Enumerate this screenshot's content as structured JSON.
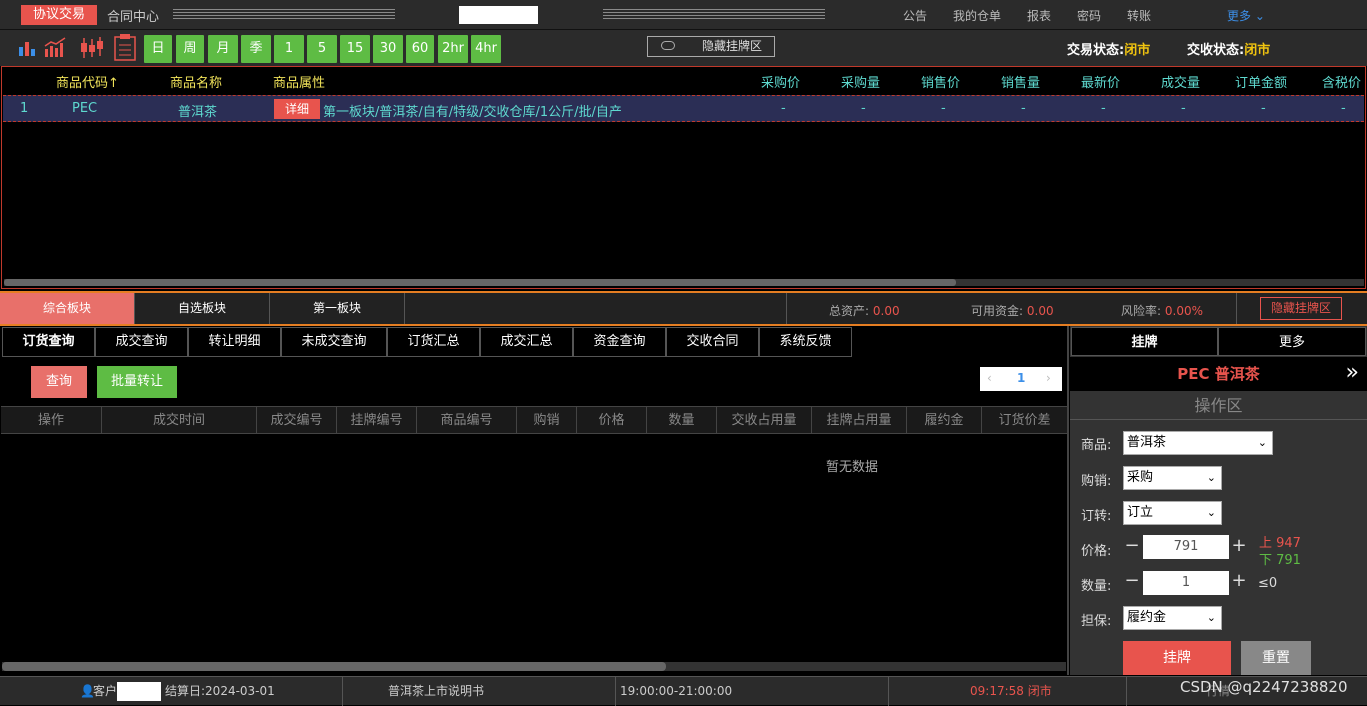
{
  "topnav": {
    "active_tab": "协议交易",
    "contract_tab": "合同中心",
    "links": [
      "公告",
      "我的仓单",
      "报表",
      "密码",
      "转账"
    ],
    "more": "更多"
  },
  "toolbar": {
    "timeframes": [
      "日",
      "周",
      "月",
      "季",
      "1",
      "5",
      "15",
      "30",
      "60",
      "2hr",
      "4hr"
    ],
    "hide_list_zone": "隐藏挂牌区",
    "trade_status_label": "交易状态:",
    "trade_status_value": "闭市",
    "settle_status_label": "交收状态:",
    "settle_status_value": "闭市"
  },
  "grid": {
    "headers": [
      "商品代码↑",
      "商品名称",
      "商品属性",
      "采购价",
      "采购量",
      "销售价",
      "销售量",
      "最新价",
      "成交量",
      "订单金额",
      "含税价"
    ],
    "row": {
      "index": "1",
      "code": "PEC",
      "name": "普洱茶",
      "detail": "详细",
      "attributes": "第一板块/普洱茶/自有/特级/交收仓库/1公斤/批/自产",
      "values": [
        "-",
        "-",
        "-",
        "-",
        "-",
        "-",
        "-",
        "-"
      ]
    }
  },
  "boards": {
    "tabs": [
      "综合板块",
      "自选板块",
      "第一板块"
    ],
    "total_assets_label": "总资产:",
    "total_assets": "0.00",
    "available_label": "可用资金:",
    "available": "0.00",
    "risk_label": "风险率:",
    "risk": "0.00%",
    "hide_list_zone": "隐藏挂牌区"
  },
  "query": {
    "tabs": [
      "订货查询",
      "成交查询",
      "转让明细",
      "未成交查询",
      "订货汇总",
      "成交汇总",
      "资金查询",
      "交收合同",
      "系统反馈"
    ],
    "query_btn": "查询",
    "batch_btn": "批量转让",
    "page": "1",
    "columns": [
      "操作",
      "成交时间",
      "成交编号",
      "挂牌编号",
      "商品编号",
      "购销",
      "价格",
      "数量",
      "交收占用量",
      "挂牌占用量",
      "履约金",
      "订货价差"
    ],
    "empty": "暂无数据"
  },
  "panel": {
    "tabs": [
      "挂牌",
      "更多"
    ],
    "title": "PEC 普洱茶",
    "zone": "操作区",
    "product_label": "商品:",
    "product": "普洱茶",
    "side_label": "购销:",
    "side": "采购",
    "type_label": "订转:",
    "type": "订立",
    "price_label": "价格:",
    "price": "791",
    "upper": "上 947",
    "lower": "下 791",
    "qty_label": "数量:",
    "qty": "1",
    "qty_limit": "≤0",
    "guarantee_label": "担保:",
    "guarantee": "履约金",
    "list_btn": "挂牌",
    "reset_btn": "重置"
  },
  "statusbar": {
    "customer": "客户",
    "settle_date": "结算日:2024-03-01",
    "notice": "普洱茶上市说明书",
    "session": "19:00:00-21:00:00",
    "clock": "09:17:58 闭市",
    "tail": "行情",
    "watermark": "CSDN @q2247238820"
  },
  "colors": {
    "accent_red": "#e8544d",
    "green": "#5ebc44",
    "teal": "#5ed9cf",
    "yellow": "#f1e35a",
    "blue": "#3c8fe8"
  }
}
